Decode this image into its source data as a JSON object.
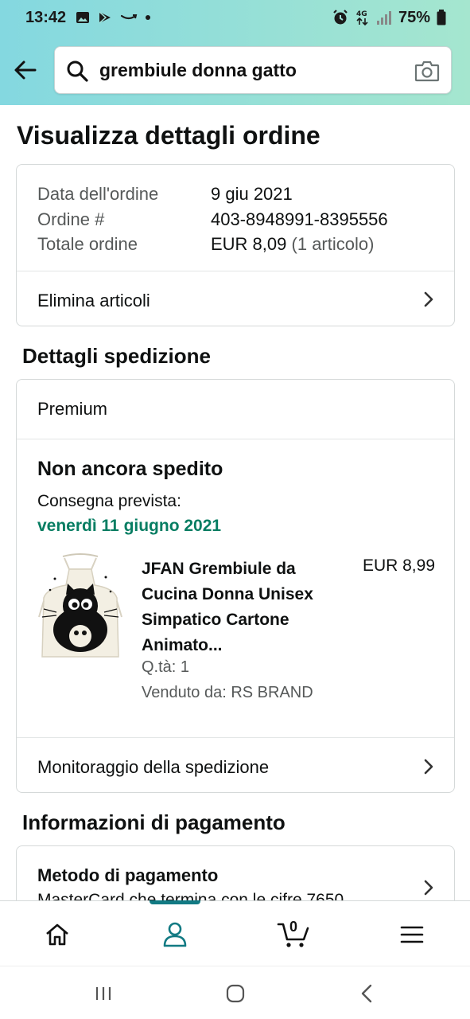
{
  "status_bar": {
    "time": "13:42",
    "network": "4G",
    "battery": "75%"
  },
  "search": {
    "query": "grembiule donna gatto"
  },
  "page_title": "Visualizza dettagli ordine",
  "order_summary": {
    "date_label": "Data dell'ordine",
    "date_value": "9 giu 2021",
    "order_label": "Ordine #",
    "order_value": "403-8948991-8395556",
    "total_label": "Totale ordine",
    "total_value": "EUR 8,09",
    "total_items": "(1 articolo)",
    "delete_items": "Elimina articoli"
  },
  "shipping": {
    "section_title": "Dettagli spedizione",
    "speed": "Premium",
    "status": "Non ancora spedito",
    "delivery_label": "Consegna prevista:",
    "delivery_date": "venerdì 11 giugno 2021",
    "product": {
      "title": "JFAN Grembiule da Cucina Donna Unisex Simpatico Cartone Animato...",
      "price": "EUR 8,99",
      "qty": "Q.tà: 1",
      "seller": "Venduto da: RS BRAND"
    },
    "tracking": "Monitoraggio della spedizione"
  },
  "payment": {
    "section_title": "Informazioni di pagamento",
    "method_label": "Metodo di pagamento",
    "method_value": "MasterCard che termina con le cifre 7650"
  },
  "bottom_nav": {
    "cart_count": "0",
    "items": [
      "home-icon",
      "account-icon",
      "cart-icon",
      "menu-icon"
    ]
  },
  "colors": {
    "header_gradient_start": "#84d8e0",
    "header_gradient_end": "#a5e6cf",
    "delivery_green": "#067d62",
    "active_teal": "#127a83"
  }
}
